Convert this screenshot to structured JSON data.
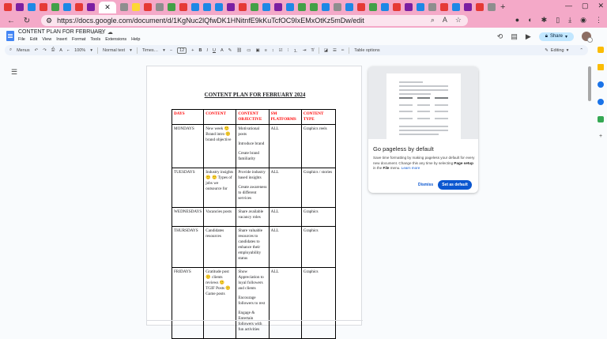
{
  "browser": {
    "tab_colors": [
      "#e53935",
      "#7b1fa2",
      "#1e88e5",
      "#e53935",
      "#43a047",
      "#1e88e5",
      "#e53935",
      "#7b1fa2",
      "#8e8e8e",
      "#fdd835",
      "#e53935",
      "#8e8e8e",
      "#43a047",
      "#e53935",
      "#1e88e5",
      "#1e88e5",
      "#1e88e5",
      "#7b1fa2",
      "#e53935",
      "#43a047",
      "#1e88e5",
      "#7b1fa2",
      "#1e88e5",
      "#43a047",
      "#43a047",
      "#1e88e5",
      "#8e8e8e",
      "#1e88e5",
      "#e53935",
      "#43a047",
      "#1e88e5",
      "#e53935",
      "#7b1fa2",
      "#1e88e5",
      "#8e8e8e",
      "#e53935",
      "#1e88e5",
      "#7b1fa2",
      "#e53935",
      "#8e8e8e"
    ],
    "active_tab_close": "✕",
    "new_tab": "+",
    "url": "https://docs.google.com/document/d/1KgNuc2lQfwDK1HNitnfE9kKuTcfOC9IxEMxOtKz5mDw/edit"
  },
  "doc": {
    "title": "CONTENT PLAN FOR FEBRUARY",
    "menus": [
      "File",
      "Edit",
      "View",
      "Insert",
      "Format",
      "Tools",
      "Extensions",
      "Help"
    ],
    "share_label": "Share"
  },
  "toolbar": {
    "search_label": "Menus",
    "zoom": "100%",
    "style": "Normal text",
    "font": "Times…",
    "font_size": "12",
    "table_options": "Table options",
    "mode": "Editing"
  },
  "page": {
    "title": "CONTENT PLAN FOR FEBRUARY 2024",
    "headers": [
      "DAYS",
      "CONTENT",
      "CONTENT OBJECTIVE",
      "SM PLATFORMS",
      "CONTENT TYPE"
    ],
    "rows": [
      {
        "day": "MONDAYS",
        "content": "New week 🙂 Brand intro 🙂 brand objective",
        "objective": [
          "Motivational posts",
          "Introduce brand",
          "Create brand familiarity"
        ],
        "platforms": "ALL",
        "type": "Graphics reels"
      },
      {
        "day": "TUESDAYS",
        "content": "Industry insights 🙂 🙂 Types of jobs we outsource for",
        "objective": [
          "Provide industry based insights",
          "Create awareness to different services"
        ],
        "platforms": "ALL",
        "type": "Graphics / stories"
      },
      {
        "day": "WEDNESDAYS",
        "content": "Vacancies posts",
        "objective": [
          "Share available vacancy roles"
        ],
        "platforms": "ALL",
        "type": "Graphics"
      },
      {
        "day": "THURSDAYS",
        "content": "Candidates resources",
        "objective": [
          "Share valuable resources to candidates to enhance their employability status"
        ],
        "platforms": "ALL",
        "type": "Graphics"
      },
      {
        "day": "FRIDAYS",
        "content": "Gratitude post 🙂 clients reviews 🙂 TGIF Posts 🙂 Game posts",
        "objective": [
          "Show Appreciation to loyal followers and clients",
          "Encourage followers to rest",
          "Engage & Entertain followers with fun activities"
        ],
        "platforms": "ALL",
        "type": "Graphics"
      }
    ]
  },
  "card": {
    "title": "Go pageless by default",
    "desc_1": "Save time formatting by making pageless your default for every new document. Change this any time by selecting ",
    "desc_bold_1": "Page setup",
    "desc_2": " in the ",
    "desc_bold_2": "File",
    "desc_3": " menu. ",
    "learn_more": "Learn more",
    "dismiss": "Dismiss",
    "set_default": "Set as default"
  }
}
